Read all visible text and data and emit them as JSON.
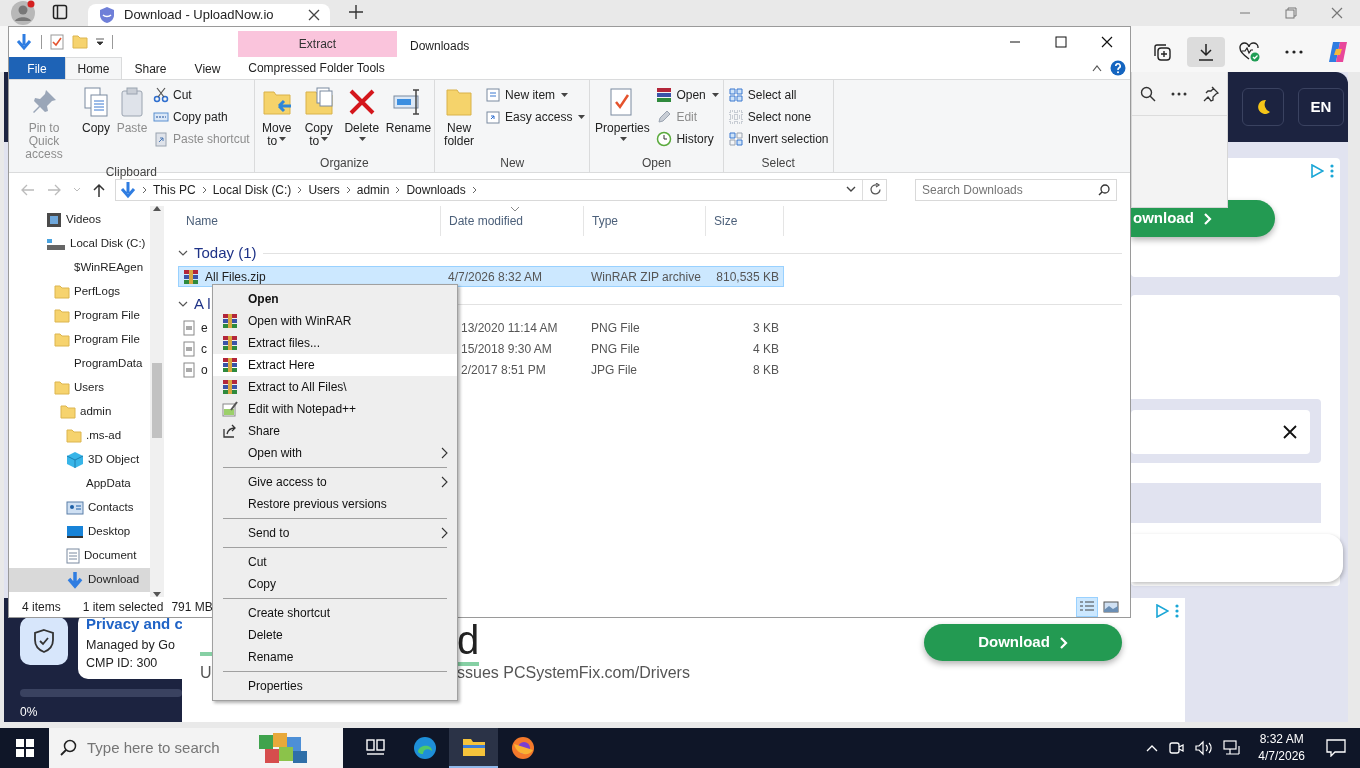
{
  "browser": {
    "tab": {
      "title": "Download - UploadNow.io",
      "selected": true
    },
    "page": {
      "language_button": "EN",
      "side_ad": {
        "button": "ownload"
      },
      "privacy": {
        "title": "Privacy and c",
        "managed_by": "Managed by Go",
        "cmp_id": "CMP ID: 300",
        "level": 0,
        "percent": "0%"
      },
      "bottom_ad": {
        "headline_end": "d",
        "subline_start": "U",
        "subline_end": "ssues PCSystemFix.com/Drivers",
        "button": "Download"
      }
    }
  },
  "explorer": {
    "title": "Downloads",
    "contextual_group": "Extract",
    "ribbon_tabs": [
      {
        "label": "File",
        "kind": "file",
        "selected": false
      },
      {
        "label": "Home",
        "kind": "tab",
        "selected": true
      },
      {
        "label": "Share",
        "kind": "tab",
        "selected": false
      },
      {
        "label": "View",
        "kind": "tab",
        "selected": false
      },
      {
        "label": "Compressed Folder Tools",
        "kind": "contextual",
        "selected": false
      }
    ],
    "ribbon_groups": [
      {
        "label": "Clipboard",
        "items": [
          {
            "label": "Pin to Quick access",
            "kind": "large",
            "disabled": true,
            "dropdown": false
          },
          {
            "label": "Copy",
            "kind": "large",
            "disabled": false,
            "dropdown": false
          },
          {
            "label": "Paste",
            "kind": "large",
            "disabled": true,
            "dropdown": false
          },
          {
            "label": "Cut",
            "kind": "small",
            "disabled": false,
            "dropdown": false
          },
          {
            "label": "Copy path",
            "kind": "small",
            "disabled": false,
            "dropdown": false
          },
          {
            "label": "Paste shortcut",
            "kind": "small",
            "disabled": true,
            "dropdown": false
          }
        ]
      },
      {
        "label": "Organize",
        "items": [
          {
            "label": "Move to",
            "kind": "large",
            "disabled": false,
            "dropdown": true
          },
          {
            "label": "Copy to",
            "kind": "large",
            "disabled": false,
            "dropdown": true
          },
          {
            "label": "Delete",
            "kind": "large",
            "disabled": false,
            "dropdown": true
          },
          {
            "label": "Rename",
            "kind": "large",
            "disabled": false,
            "dropdown": false
          }
        ]
      },
      {
        "label": "New",
        "items": [
          {
            "label": "New folder",
            "kind": "large",
            "disabled": false,
            "dropdown": false
          },
          {
            "label": "New item",
            "kind": "small",
            "disabled": false,
            "dropdown": true
          },
          {
            "label": "Easy access",
            "kind": "small",
            "disabled": false,
            "dropdown": true
          }
        ]
      },
      {
        "label": "Open",
        "items": [
          {
            "label": "Properties",
            "kind": "large",
            "disabled": false,
            "dropdown": true
          },
          {
            "label": "Open",
            "kind": "small",
            "disabled": false,
            "dropdown": true
          },
          {
            "label": "Edit",
            "kind": "small",
            "disabled": true,
            "dropdown": false
          },
          {
            "label": "History",
            "kind": "small",
            "disabled": false,
            "dropdown": false
          }
        ]
      },
      {
        "label": "Select",
        "items": [
          {
            "label": "Select all",
            "kind": "small",
            "disabled": false,
            "dropdown": false
          },
          {
            "label": "Select none",
            "kind": "small",
            "disabled": false,
            "dropdown": false
          },
          {
            "label": "Invert selection",
            "kind": "small",
            "disabled": false,
            "dropdown": false
          }
        ]
      }
    ],
    "breadcrumbs": [
      "This PC",
      "Local Disk (C:)",
      "Users",
      "admin",
      "Downloads"
    ],
    "search": {
      "placeholder": "Search Downloads"
    },
    "navigation": [
      {
        "label": "Videos",
        "faded": false,
        "selected": false
      },
      {
        "label": "Local Disk (C:)",
        "faded": false,
        "selected": false,
        "children": [
          {
            "label": "$WinREAgen",
            "faded": true,
            "selected": false
          },
          {
            "label": "PerfLogs",
            "faded": false,
            "selected": false
          },
          {
            "label": "Program File",
            "faded": false,
            "selected": false
          },
          {
            "label": "Program File",
            "faded": false,
            "selected": false
          },
          {
            "label": "ProgramData",
            "faded": true,
            "selected": false
          },
          {
            "label": "Users",
            "faded": false,
            "selected": false,
            "children": [
              {
                "label": "admin",
                "faded": false,
                "selected": false,
                "children": [
                  {
                    "label": ".ms-ad",
                    "faded": false,
                    "selected": false
                  },
                  {
                    "label": "3D Object",
                    "faded": false,
                    "selected": false
                  },
                  {
                    "label": "AppData",
                    "faded": true,
                    "selected": false
                  },
                  {
                    "label": "Contacts",
                    "faded": false,
                    "selected": false
                  },
                  {
                    "label": "Desktop",
                    "faded": false,
                    "selected": false
                  },
                  {
                    "label": "Document",
                    "faded": false,
                    "selected": false
                  },
                  {
                    "label": "Download",
                    "faded": false,
                    "selected": true
                  }
                ]
              }
            ]
          }
        ]
      }
    ],
    "columns": [
      "Name",
      "Date modified",
      "Type",
      "Size"
    ],
    "file_groups": [
      {
        "label": "Today (1)",
        "files": [
          {
            "name": "All Files.zip",
            "date": "4/7/2026 8:32 AM",
            "type": "WinRAR ZIP archive",
            "size": "810,535 KB",
            "selected": true
          }
        ]
      },
      {
        "label": "A l",
        "files": [
          {
            "name": "e",
            "date": "13/2020 11:14 AM",
            "type": "PNG File",
            "size": "3 KB",
            "selected": false
          },
          {
            "name": "c",
            "date": "15/2018 9:30 AM",
            "type": "PNG File",
            "size": "4 KB",
            "selected": false
          },
          {
            "name": "o",
            "date": "2/2017 8:51 PM",
            "type": "JPG File",
            "size": "8 KB",
            "selected": false
          }
        ]
      }
    ],
    "status": {
      "items": "4 items",
      "selection": "1 item selected",
      "size": "791 MB"
    },
    "view_modes": [
      {
        "selected": true
      },
      {
        "selected": false
      }
    ]
  },
  "context_menu": [
    {
      "kind": "item",
      "label": "Open",
      "default": true,
      "selected": false,
      "submenu": false
    },
    {
      "kind": "item",
      "label": "Open with WinRAR",
      "default": false,
      "selected": false,
      "submenu": false
    },
    {
      "kind": "item",
      "label": "Extract files...",
      "default": false,
      "selected": false,
      "submenu": false
    },
    {
      "kind": "item",
      "label": "Extract Here",
      "default": false,
      "selected": true,
      "submenu": false
    },
    {
      "kind": "item",
      "label": "Extract to All Files\\",
      "default": false,
      "selected": false,
      "submenu": false
    },
    {
      "kind": "item",
      "label": "Edit with Notepad++",
      "default": false,
      "selected": false,
      "submenu": false
    },
    {
      "kind": "item",
      "label": "Share",
      "default": false,
      "selected": false,
      "submenu": false
    },
    {
      "kind": "item",
      "label": "Open with",
      "default": false,
      "selected": false,
      "submenu": true
    },
    {
      "kind": "separator"
    },
    {
      "kind": "item",
      "label": "Give access to",
      "default": false,
      "selected": false,
      "submenu": true
    },
    {
      "kind": "item",
      "label": "Restore previous versions",
      "default": false,
      "selected": false,
      "submenu": false
    },
    {
      "kind": "separator"
    },
    {
      "kind": "item",
      "label": "Send to",
      "default": false,
      "selected": false,
      "submenu": true
    },
    {
      "kind": "separator"
    },
    {
      "kind": "item",
      "label": "Cut",
      "default": false,
      "selected": false,
      "submenu": false
    },
    {
      "kind": "item",
      "label": "Copy",
      "default": false,
      "selected": false,
      "submenu": false
    },
    {
      "kind": "separator"
    },
    {
      "kind": "item",
      "label": "Create shortcut",
      "default": false,
      "selected": false,
      "submenu": false
    },
    {
      "kind": "item",
      "label": "Delete",
      "default": false,
      "selected": false,
      "submenu": false
    },
    {
      "kind": "item",
      "label": "Rename",
      "default": false,
      "selected": false,
      "submenu": false
    },
    {
      "kind": "separator"
    },
    {
      "kind": "item",
      "label": "Properties",
      "default": false,
      "selected": false,
      "submenu": false
    }
  ],
  "taskbar": {
    "search_placeholder": "Type here to search",
    "apps": [
      {
        "selected": false
      },
      {
        "selected": false
      },
      {
        "selected": true
      },
      {
        "selected": false
      }
    ],
    "time": "8:32 AM",
    "date": "4/7/2026"
  }
}
